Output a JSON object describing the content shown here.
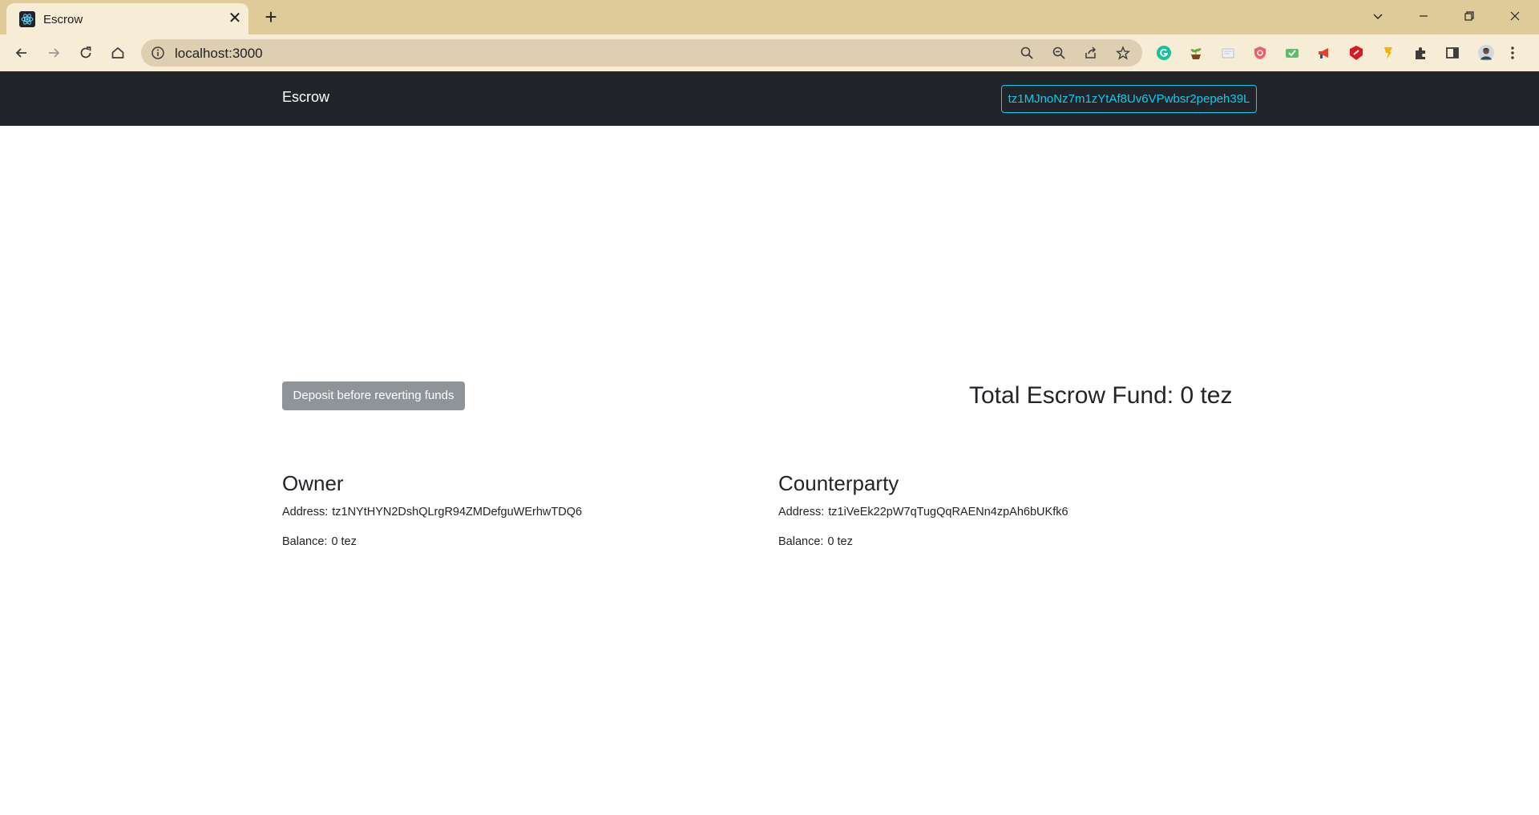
{
  "browser": {
    "tab_title": "Escrow",
    "url": "localhost:3000",
    "favicon": "react-logo-icon",
    "extensions": [
      "grammarly-icon",
      "plant-icon",
      "page-icon",
      "shield-icon",
      "check-mail-icon",
      "megaphone-icon",
      "red-badge-icon",
      "flashlight-icon",
      "puzzle-icon",
      "side-panel-icon",
      "avatar"
    ]
  },
  "navbar": {
    "brand": "Escrow",
    "wallet_address": "tz1MJnoNz7m1zYtAf8Uv6VPwbsr2pepeh39L"
  },
  "main": {
    "deposit_label": "Deposit before reverting funds",
    "total_fund": "Total Escrow Fund: 0 tez"
  },
  "owner": {
    "title": "Owner",
    "address_label": "Address:",
    "address": "tz1NYtHYN2DshQLrgR94ZMDefguWErhwTDQ6",
    "balance_label": "Balance:",
    "balance": "0 tez"
  },
  "counterparty": {
    "title": "Counterparty",
    "address_label": "Address:",
    "address": "tz1iVeEk22pW7qTugQqRAENn4zpAh6bUKfk6",
    "balance_label": "Balance:",
    "balance": "0 tez"
  },
  "colors": {
    "chrome_frame": "#dfca9a",
    "chrome_toolbar": "#f7ecd6",
    "navbar": "#212529",
    "accent": "#0dcaf0",
    "button_disabled": "#8f9499"
  }
}
